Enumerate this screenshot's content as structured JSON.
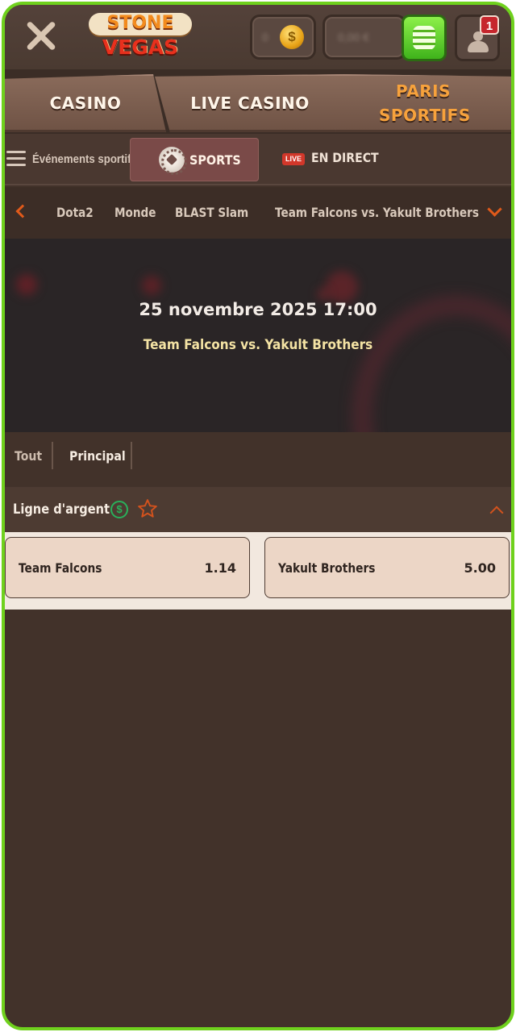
{
  "header": {
    "logo_line1": "STONE",
    "logo_line2": "VEGAS",
    "coins_value": "0",
    "coin_symbol": "$",
    "balance_value": "0,00 €",
    "notification_count": "1"
  },
  "main_nav": {
    "tabs": [
      {
        "label": "CASINO"
      },
      {
        "label": "LIVE CASINO"
      },
      {
        "label": "PARIS SPORTIFS"
      }
    ]
  },
  "sub_nav": {
    "events_label": "Événements sportifs",
    "sports_label": "SPORTS",
    "live_badge": "LIVE",
    "live_label": "EN DIRECT"
  },
  "breadcrumb": {
    "items": [
      "Dota2",
      "Monde",
      "BLAST Slam",
      "Team Falcons vs. Yakult Brothers"
    ]
  },
  "match": {
    "datetime": "25 novembre 2025 17:00",
    "teams": "Team Falcons vs. Yakult Brothers"
  },
  "market_tabs": {
    "items": [
      "Tout",
      "Principal"
    ]
  },
  "market": {
    "title": "Ligne d'argent",
    "dollar_symbol": "$",
    "outcomes": [
      {
        "name": "Team Falcons",
        "odds": "1.14"
      },
      {
        "name": "Yakult Brothers",
        "odds": "5.00"
      }
    ]
  },
  "colors": {
    "frame": "#6fd11d",
    "accent_orange": "#f7a23c",
    "chevron": "#e05a1a",
    "background": "#42322a",
    "odds_button": "#ecd6c6"
  }
}
